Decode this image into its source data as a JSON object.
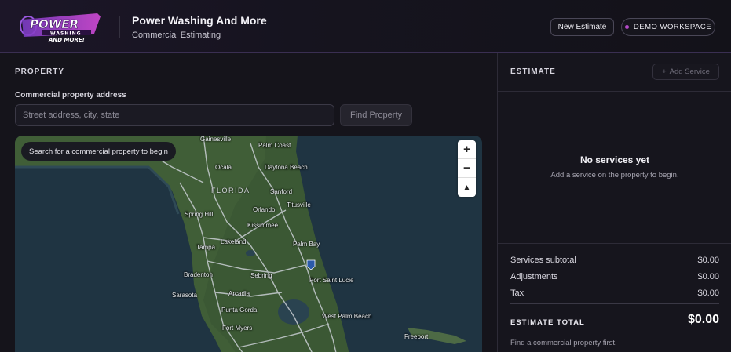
{
  "header": {
    "logo_text": "POWER WASHING AND MORE!",
    "company_name": "Power Washing And More",
    "company_subtitle": "Commercial Estimating",
    "new_estimate_label": "New Estimate",
    "workspace_badge": "DEMO WORKSPACE"
  },
  "property": {
    "section_title": "PROPERTY",
    "address_label": "Commercial property address",
    "address_placeholder": "Street address, city, state",
    "address_value": "",
    "find_button_label": "Find Property",
    "map": {
      "tooltip": "Search for a commercial property to begin",
      "zoom_in": "+",
      "zoom_out": "−",
      "reset_north": "▲",
      "state_label": "FLORIDA",
      "cities": [
        "Gainesville",
        "Palm Coast",
        "Ocala",
        "Daytona Beach",
        "Sanford",
        "Spring Hill",
        "Orlando",
        "Titusville",
        "Kissimmee",
        "Lakeland",
        "Tampa",
        "Palm Bay",
        "Bradenton",
        "Sebring",
        "Port Saint Lucie",
        "Sarasota",
        "Arcadia",
        "Punta Gorda",
        "Fort Myers",
        "West Palm Beach",
        "Freeport"
      ],
      "highway_shield": "95"
    }
  },
  "estimate": {
    "section_title": "ESTIMATE",
    "add_service_label": "Add Service",
    "empty_title": "No services yet",
    "empty_subtitle": "Add a service on the property to begin.",
    "rows": [
      {
        "label": "Services subtotal",
        "value": "$0.00"
      },
      {
        "label": "Adjustments",
        "value": "$0.00"
      },
      {
        "label": "Tax",
        "value": "$0.00"
      }
    ],
    "total_label": "ESTIMATE TOTAL",
    "total_value": "$0.00",
    "total_note": "Find a commercial property first."
  },
  "colors": {
    "background": "#14131c",
    "accent_purple": "#b54bc9",
    "map_water": "#1f3442",
    "map_land": "#3d5a36"
  }
}
